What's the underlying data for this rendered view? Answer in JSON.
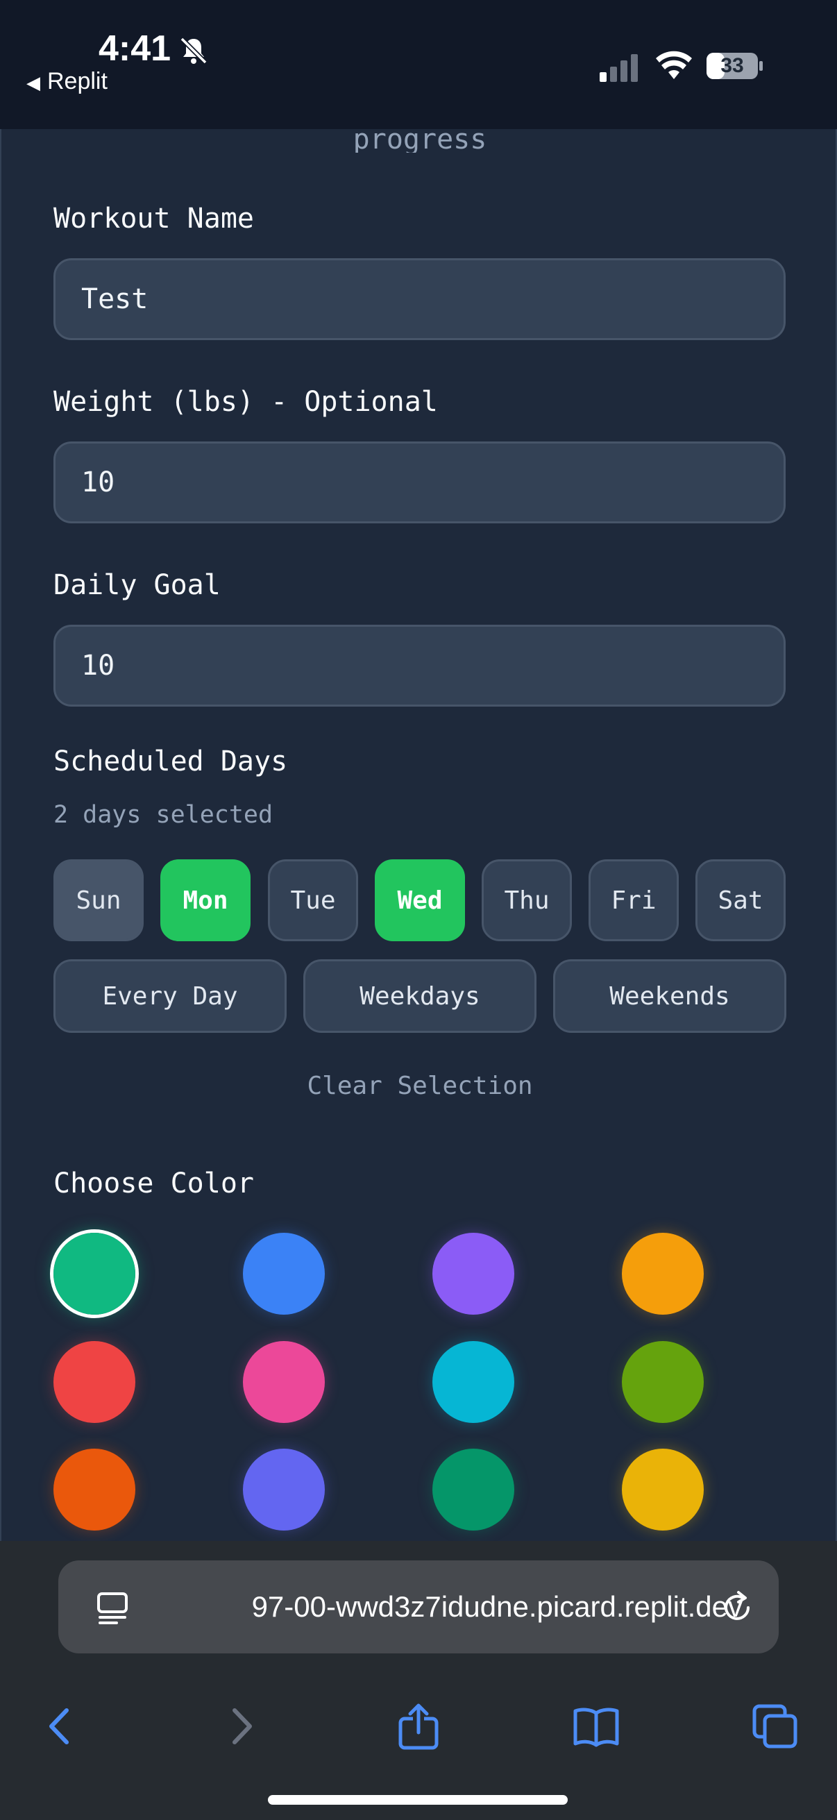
{
  "status_bar": {
    "time": "4:41",
    "back_label": "Replit",
    "battery": "33"
  },
  "main": {
    "progress_text": "progress",
    "workout_name": {
      "label": "Workout Name",
      "value": "Test"
    },
    "weight": {
      "label": "Weight (lbs) - Optional",
      "value": "10"
    },
    "daily_goal": {
      "label": "Daily Goal",
      "value": "10"
    },
    "scheduled": {
      "label": "Scheduled Days",
      "summary": "2 days selected",
      "days": [
        "Sun",
        "Mon",
        "Tue",
        "Wed",
        "Thu",
        "Fri",
        "Sat"
      ],
      "selected": [
        "Mon",
        "Wed"
      ],
      "presets": [
        "Every Day",
        "Weekdays",
        "Weekends"
      ],
      "clear_label": "Clear Selection"
    },
    "color": {
      "label": "Choose Color",
      "swatches": [
        "#10b981",
        "#3b82f6",
        "#8b5cf6",
        "#f59e0b",
        "#ef4444",
        "#ec4899",
        "#06b6d4",
        "#65a30d",
        "#ea580c",
        "#6366f1",
        "#059669",
        "#eab308"
      ],
      "selected_index": 0
    }
  },
  "browser": {
    "url": "97-00-wwd3z7idudne.picard.replit.dev"
  },
  "colors": {
    "accent_green": "#22c55e",
    "background": "#1e293b"
  }
}
